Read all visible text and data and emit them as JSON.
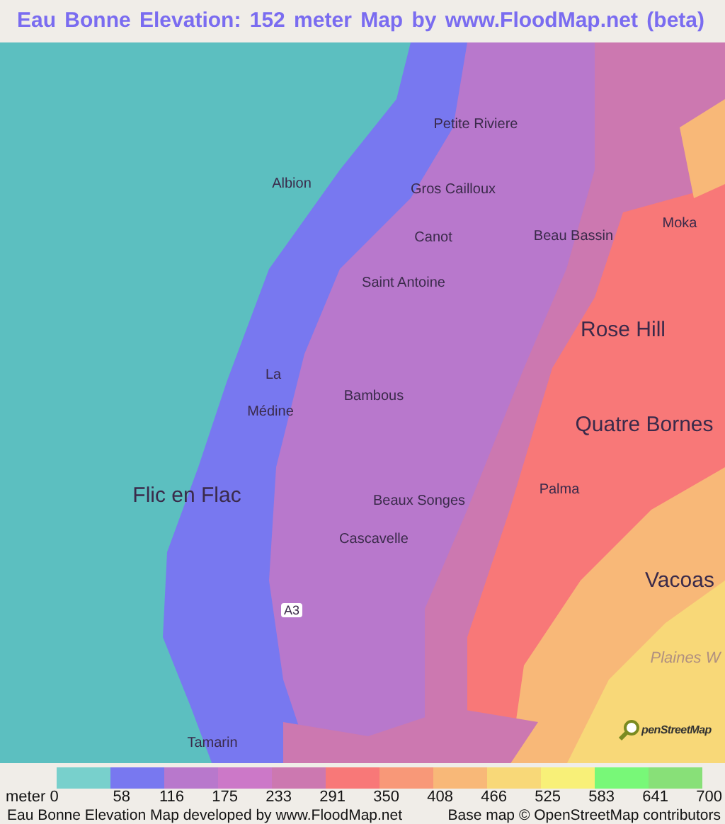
{
  "title": "Eau Bonne Elevation: 152 meter Map by www.FloodMap.net (beta)",
  "map": {
    "labels": [
      {
        "text": "Petite Riviere",
        "kind": "place"
      },
      {
        "text": "Albion",
        "kind": "place"
      },
      {
        "text": "Gros Cailloux",
        "kind": "place"
      },
      {
        "text": "Moka",
        "kind": "place"
      },
      {
        "text": "Canot",
        "kind": "place"
      },
      {
        "text": "Beau Bassin",
        "kind": "place"
      },
      {
        "text": "Saint Antoine",
        "kind": "place"
      },
      {
        "text": "Rose Hill",
        "kind": "town"
      },
      {
        "text": "La",
        "kind": "place"
      },
      {
        "text": "Bambous",
        "kind": "place"
      },
      {
        "text": "Médine",
        "kind": "place"
      },
      {
        "text": "Quatre Bornes",
        "kind": "town"
      },
      {
        "text": "Palma",
        "kind": "place"
      },
      {
        "text": "Flic en Flac",
        "kind": "town"
      },
      {
        "text": "Beaux Songes",
        "kind": "place"
      },
      {
        "text": "Cascavelle",
        "kind": "place"
      },
      {
        "text": "Vacoas",
        "kind": "town"
      },
      {
        "text": "A3",
        "kind": "road"
      },
      {
        "text": "Plaines W",
        "kind": "area"
      },
      {
        "text": "Tamarin",
        "kind": "place"
      }
    ],
    "osm_logo": "penStreetMap"
  },
  "legend": {
    "unit": "meter",
    "swatches": [
      {
        "color": "#78d0cc",
        "value": "0"
      },
      {
        "color": "#7878f0",
        "value": "58"
      },
      {
        "color": "#b878cc",
        "value": "116"
      },
      {
        "color": "#cc78c8",
        "value": "175"
      },
      {
        "color": "#cc78b0",
        "value": "233"
      },
      {
        "color": "#f87878",
        "value": "291"
      },
      {
        "color": "#f89878",
        "value": "350"
      },
      {
        "color": "#f8b878",
        "value": "408"
      },
      {
        "color": "#f8d878",
        "value": "466"
      },
      {
        "color": "#f8f078",
        "value": "525"
      },
      {
        "color": "#78f878",
        "value": "583"
      },
      {
        "color": "#88e078",
        "value": "641"
      }
    ],
    "max_value": "700"
  },
  "footer": {
    "left": "Eau Bonne Elevation Map developed by www.FloodMap.net",
    "right": "Base map © OpenStreetMap contributors"
  }
}
